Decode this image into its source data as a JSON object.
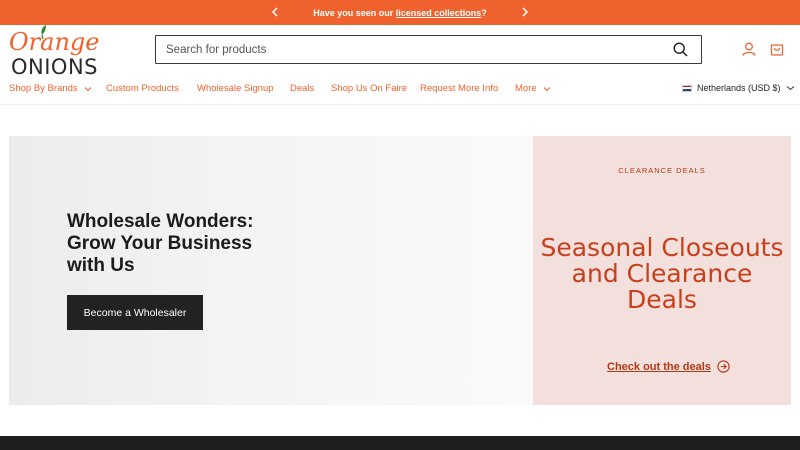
{
  "announcement": {
    "prefix": "Have you seen our ",
    "link": "licensed collections",
    "suffix": "?"
  },
  "logo": {
    "line1": "Orange",
    "line2": "ONIONS"
  },
  "search": {
    "placeholder": "Search for products"
  },
  "nav": {
    "items": [
      {
        "label": "Shop By Brands",
        "has_dropdown": true
      },
      {
        "label": "Custom Products",
        "has_dropdown": false
      },
      {
        "label": "Wholesale Signup",
        "has_dropdown": false
      },
      {
        "label": "Deals",
        "has_dropdown": false
      },
      {
        "label": "Shop Us On Faire",
        "has_dropdown": false
      },
      {
        "label": "Request More Info",
        "has_dropdown": false
      },
      {
        "label": "More",
        "has_dropdown": true
      }
    ],
    "country": "Netherlands (USD $)"
  },
  "hero": {
    "title": "Wholesale Wonders: Grow Your Business with Us",
    "button": "Become a Wholesaler"
  },
  "promo": {
    "eyebrow": "CLEARANCE DEALS",
    "title": "Seasonal Closeouts and Clearance Deals",
    "link": "Check out the deals"
  },
  "colors": {
    "brand_orange": "#f0622d",
    "promo_red": "#c8401b",
    "promo_bg": "#f3dfdc",
    "dark": "#222222"
  }
}
